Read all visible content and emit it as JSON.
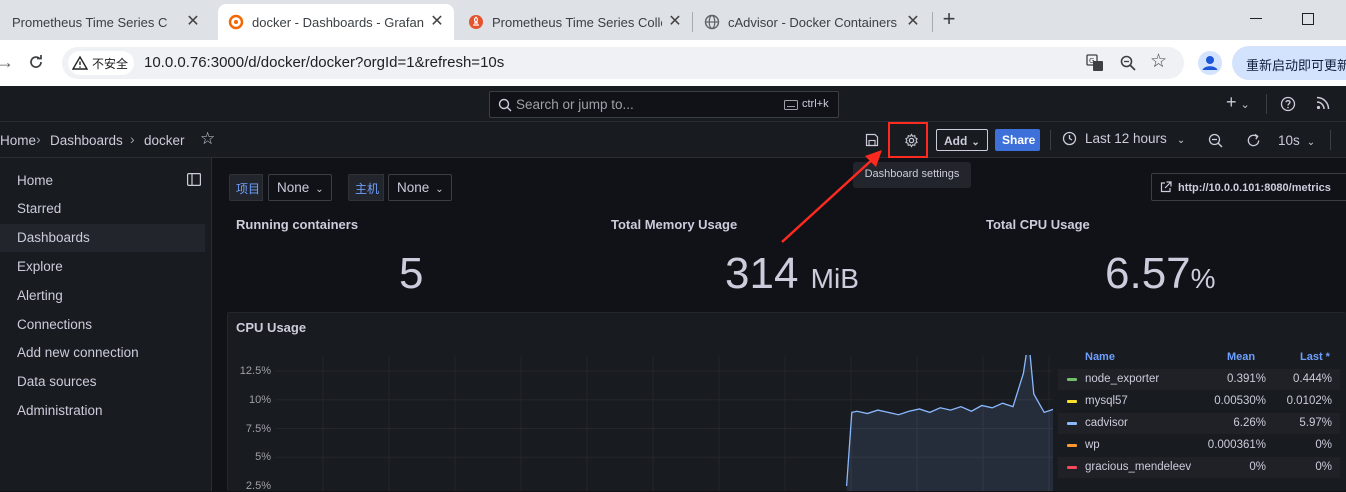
{
  "browser": {
    "tabs": [
      {
        "title": "Prometheus Time Series Colle"
      },
      {
        "title": "docker - Dashboards - Grafan"
      },
      {
        "title": "Prometheus Time Series Colle"
      },
      {
        "title": "cAdvisor - Docker Containers"
      }
    ],
    "new_tab_label": "+",
    "not_secure_label": "不安全",
    "url": "10.0.0.76:3000/d/docker/docker?orgId=1&refresh=10s",
    "restart_label": "重新启动即可更新"
  },
  "grafana": {
    "search_placeholder": "Search or jump to...",
    "search_shortcut": "ctrl+k",
    "breadcrumb": {
      "home": "Home",
      "dashboards": "Dashboards",
      "current": "docker"
    },
    "toolbar": {
      "add_label": "Add",
      "share_label": "Share",
      "time_range": "Last 12 hours",
      "refresh_interval": "10s",
      "settings_tooltip": "Dashboard settings"
    },
    "sidebar": {
      "items": [
        "Home",
        "Starred",
        "Dashboards",
        "Explore",
        "Alerting",
        "Connections",
        "Add new connection",
        "Data sources",
        "Administration"
      ],
      "active": "Dashboards"
    },
    "variables": [
      {
        "label": "项目",
        "value": "None"
      },
      {
        "label": "主机",
        "value": "None"
      }
    ],
    "metrics_link": "http://10.0.0.101:8080/metrics",
    "stats": [
      {
        "title": "Running containers",
        "value": "5",
        "unit": ""
      },
      {
        "title": "Total Memory Usage",
        "value": "314",
        "unit": "MiB"
      },
      {
        "title": "Total CPU Usage",
        "value": "6.57",
        "unit": "%"
      }
    ],
    "cpu_panel": {
      "title": "CPU Usage",
      "y_ticks": [
        "12.5%",
        "10%",
        "7.5%",
        "5%",
        "2.5%"
      ],
      "legend_headers": {
        "name": "Name",
        "mean": "Mean",
        "last": "Last *"
      },
      "legend": [
        {
          "name": "node_exporter",
          "mean": "0.391%",
          "last": "0.444%",
          "color": "#73bf69"
        },
        {
          "name": "mysql57",
          "mean": "0.00530%",
          "last": "0.0102%",
          "color": "#fade2a"
        },
        {
          "name": "cadvisor",
          "mean": "6.26%",
          "last": "5.97%",
          "color": "#8ab8ff"
        },
        {
          "name": "wp",
          "mean": "0.000361%",
          "last": "0%",
          "color": "#ff9830"
        },
        {
          "name": "gracious_mendeleev",
          "mean": "0%",
          "last": "0%",
          "color": "#f2495c"
        }
      ]
    }
  },
  "chart_data": {
    "type": "line",
    "title": "CPU Usage",
    "ylim": [
      0,
      13.5
    ],
    "y_ticks": [
      "12.5%",
      "10%",
      "7.5%",
      "5%",
      "2.5%"
    ],
    "series": [
      {
        "name": "cadvisor",
        "color": "#8ab8ff",
        "x": [
          0.0,
          0.88,
          0.89,
          0.9,
          0.92,
          0.94,
          0.96,
          0.98,
          1.0,
          1.02,
          1.04,
          1.06,
          1.08,
          1.1,
          1.12,
          1.14,
          1.16,
          1.18,
          1.2,
          1.22,
          1.23,
          1.24,
          1.26,
          1.28,
          1.3,
          1.32,
          1.34,
          1.36,
          1.38,
          1.4,
          1.42,
          1.44,
          1.46,
          1.48,
          1.5
        ],
        "values": [
          0,
          0,
          6.4,
          6.5,
          6.3,
          6.6,
          6.4,
          6.2,
          6.5,
          6.7,
          6.4,
          6.8,
          6.6,
          6.9,
          6.5,
          7.0,
          6.8,
          7.2,
          6.9,
          9.8,
          12.8,
          8.0,
          6.4,
          6.7,
          7.5,
          6.6,
          6.4,
          7.0,
          6.5,
          6.3,
          6.6,
          6.2,
          6.5,
          6.3,
          6.4
        ]
      }
    ]
  }
}
